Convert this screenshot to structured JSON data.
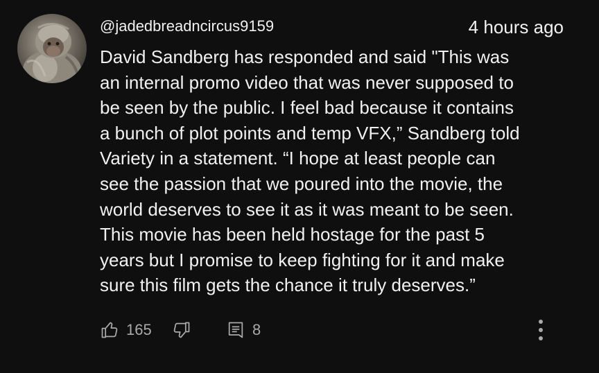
{
  "comment": {
    "author": "@jadedbreadncircus9159",
    "time": "4 hours ago",
    "lines": [
      "David Sandberg has responded and said \"This was",
      "an internal promo video that was never supposed to",
      "be seen by the public. I feel bad because it contains",
      "a bunch of plot points and temp VFX,” Sandberg told",
      "Variety in a statement. “I hope at least people can",
      "see the passion that we poured into the movie, the",
      "world deserves to see it as it was meant to be seen.",
      "This movie has been held hostage for the past 5",
      "years but I promise to keep fighting for it and make",
      "sure this film gets the chance it truly deserves.”"
    ],
    "like_count": "165",
    "reply_count": "8"
  },
  "icons": {
    "like": "thumbs-up-icon",
    "dislike": "thumbs-down-icon",
    "replies": "comment-replies-icon",
    "more": "more-vertical-icon"
  },
  "colors": {
    "background": "#0f0f0f",
    "text": "#f1f1f1",
    "secondary": "#aaaaaa"
  }
}
